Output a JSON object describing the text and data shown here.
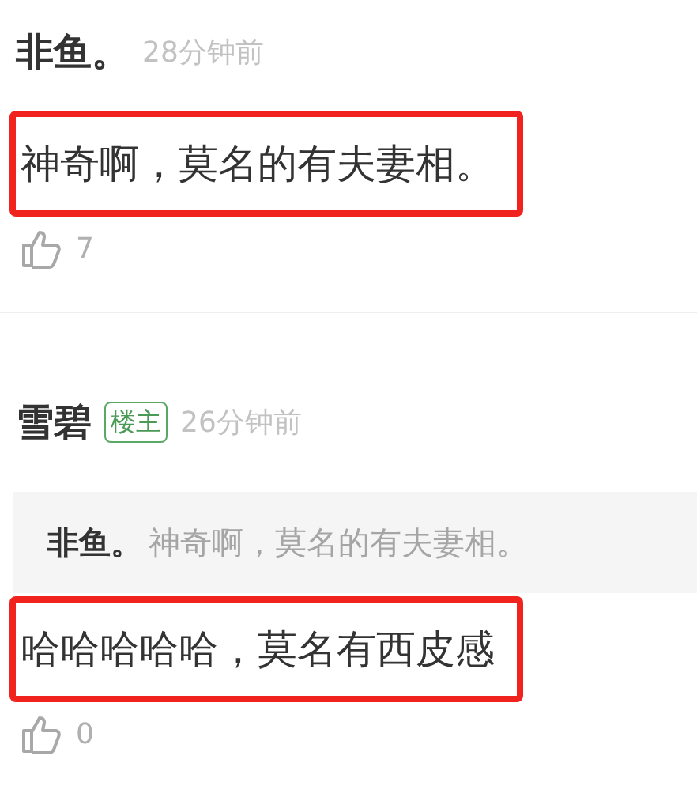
{
  "comments": [
    {
      "author": "非鱼。",
      "time": "28分钟前",
      "text": "神奇啊，莫名的有夫妻相。",
      "highlighted": true,
      "likes": "7"
    },
    {
      "author": "雪碧",
      "badge": "楼主",
      "time": "26分钟前",
      "quote": {
        "author": "非鱼。",
        "text": "神奇啊，莫名的有夫妻相。"
      },
      "text": "哈哈哈哈哈，莫名有西皮感",
      "highlighted": true,
      "likes": "0"
    }
  ]
}
